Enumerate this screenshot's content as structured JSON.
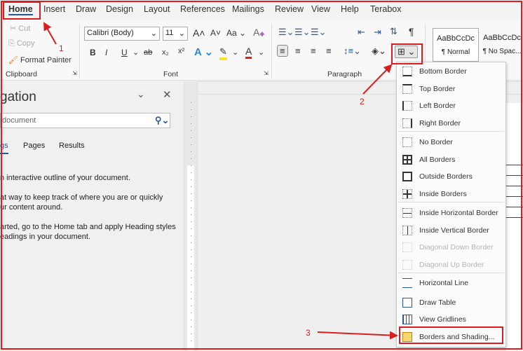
{
  "tabs": [
    "Home",
    "Insert",
    "Draw",
    "Design",
    "Layout",
    "References",
    "Mailings",
    "Review",
    "View",
    "Help",
    "Terabox"
  ],
  "clipboard": {
    "cut": "Cut",
    "copy": "Copy",
    "format_painter": "Format Painter",
    "label": "Clipboard"
  },
  "font": {
    "name": "Calibri (Body)",
    "size": "11",
    "label": "Font",
    "bold": "B",
    "italic": "I",
    "underline": "U",
    "strike": "ab",
    "sub": "x₂",
    "sup": "x²",
    "case": "Aa"
  },
  "paragraph": {
    "label": "Paragraph"
  },
  "styles": [
    {
      "preview": "AaBbCcDc",
      "name": "¶ Normal"
    },
    {
      "preview": "AaBbCcDc",
      "name": "¶ No Spac..."
    }
  ],
  "nav": {
    "title": "gation",
    "search_placeholder": "document",
    "tabs": [
      "gs",
      "Pages",
      "Results"
    ],
    "lines": [
      "n interactive outline of your document.",
      "at way to keep track of where you are or quickly",
      "ur content around.",
      "arted, go to the Home tab and apply Heading styles",
      "eadings in your document."
    ]
  },
  "menu": {
    "items": [
      "Bottom Border",
      "Top Border",
      "Left Border",
      "Right Border",
      "No Border",
      "All Borders",
      "Outside Borders",
      "Inside Borders",
      "Inside Horizontal Border",
      "Inside Vertical Border",
      "Diagonal Down Border",
      "Diagonal Up Border",
      "Horizontal Line",
      "Draw Table",
      "View Gridlines",
      "Borders and Shading..."
    ]
  },
  "annotations": [
    "1",
    "2",
    "3"
  ],
  "colors": {
    "annotation": "#d81e1e",
    "accent": "#2b579a"
  }
}
